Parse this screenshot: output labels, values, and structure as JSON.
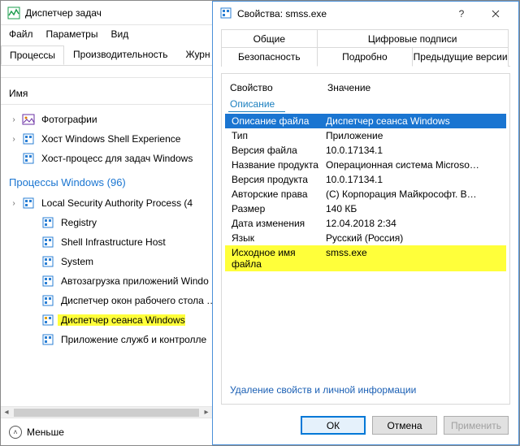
{
  "taskmgr": {
    "title": "Диспетчер задач",
    "menu": {
      "file": "Файл",
      "options": "Параметры",
      "view": "Вид"
    },
    "tabs": {
      "processes": "Процессы",
      "performance": "Производительность",
      "journal": "Журн"
    },
    "header_name": "Имя",
    "rows": [
      {
        "caret": "›",
        "label": "Фотографии"
      },
      {
        "caret": "›",
        "label": "Хост Windows Shell Experience"
      },
      {
        "caret": "",
        "label": "Хост-процесс для задач Windows"
      }
    ],
    "group_label": "Процессы Windows (96)",
    "win_rows": [
      {
        "caret": "›",
        "label": "Local Security Authority Process (4"
      },
      {
        "caret": "",
        "label": "Registry"
      },
      {
        "caret": "",
        "label": "Shell Infrastructure Host"
      },
      {
        "caret": "",
        "label": "System"
      },
      {
        "caret": "",
        "label": "Автозагрузка приложений Windo"
      },
      {
        "caret": "",
        "label": "Диспетчер окон рабочего стола …"
      },
      {
        "caret": "",
        "label": "Диспетчер сеанса  Windows",
        "hl": true
      },
      {
        "caret": "",
        "label": "Приложение служб и контролле"
      }
    ],
    "less": "Меньше"
  },
  "dlg": {
    "title": "Свойства: smss.exe",
    "tabs": {
      "general": "Общие",
      "signatures": "Цифровые подписи",
      "security": "Безопасность",
      "details": "Подробно",
      "previous": "Предыдущие версии"
    },
    "head": {
      "property": "Свойство",
      "value": "Значение"
    },
    "group": "Описание",
    "props": [
      {
        "k": "Описание файла",
        "v": "Диспетчер сеанса  Windows",
        "selected": true
      },
      {
        "k": "Тип",
        "v": "Приложение"
      },
      {
        "k": "Версия файла",
        "v": "10.0.17134.1"
      },
      {
        "k": "Название продукта",
        "v": "Операционная система Microso…"
      },
      {
        "k": "Версия продукта",
        "v": "10.0.17134.1"
      },
      {
        "k": "Авторские права",
        "v": "(C) Корпорация Майкрософт. В…"
      },
      {
        "k": "Размер",
        "v": "140 КБ"
      },
      {
        "k": "Дата изменения",
        "v": "12.04.2018 2:34"
      },
      {
        "k": "Язык",
        "v": "Русский (Россия)"
      },
      {
        "k": "Исходное имя файла",
        "v": "smss.exe",
        "hl": true
      }
    ],
    "link": "Удаление свойств и личной информации",
    "buttons": {
      "ok": "ОК",
      "cancel": "Отмена",
      "apply": "Применить"
    }
  }
}
